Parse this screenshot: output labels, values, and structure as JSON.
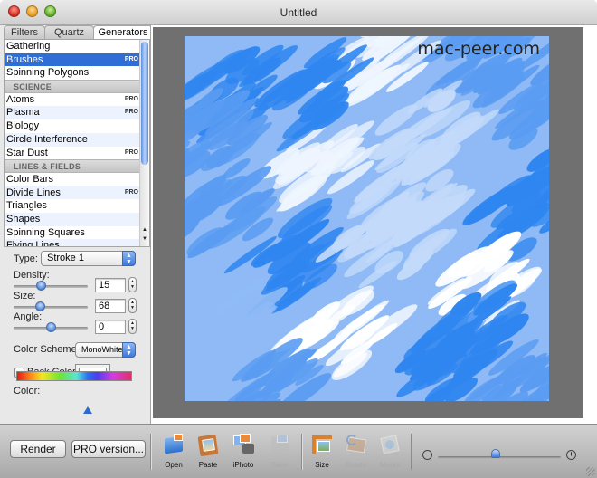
{
  "window": {
    "title": "Untitled"
  },
  "tabs": [
    {
      "label": "Filters",
      "active": false
    },
    {
      "label": "Quartz",
      "active": false
    },
    {
      "label": "Generators",
      "active": true
    }
  ],
  "list": {
    "rows": [
      {
        "kind": "item",
        "label": "Gathering",
        "pro": ""
      },
      {
        "kind": "item",
        "label": "Brushes",
        "pro": "PRO",
        "selected": true
      },
      {
        "kind": "item",
        "label": "Spinning Polygons",
        "pro": ""
      },
      {
        "kind": "group",
        "label": "SCIENCE"
      },
      {
        "kind": "item",
        "label": "Atoms",
        "pro": "PRO"
      },
      {
        "kind": "item",
        "label": "Plasma",
        "pro": "PRO"
      },
      {
        "kind": "item",
        "label": "Biology",
        "pro": ""
      },
      {
        "kind": "item",
        "label": "Circle Interference",
        "pro": ""
      },
      {
        "kind": "item",
        "label": "Star Dust",
        "pro": "PRO"
      },
      {
        "kind": "group",
        "label": "LINES & FIELDS"
      },
      {
        "kind": "item",
        "label": "Color Bars",
        "pro": ""
      },
      {
        "kind": "item",
        "label": "Divide Lines",
        "pro": "PRO"
      },
      {
        "kind": "item",
        "label": "Triangles",
        "pro": ""
      },
      {
        "kind": "item",
        "label": "Shapes",
        "pro": ""
      },
      {
        "kind": "item",
        "label": "Spinning Squares",
        "pro": ""
      },
      {
        "kind": "item",
        "label": "Flying Lines",
        "pro": ""
      }
    ]
  },
  "controls": {
    "type_label": "Type:",
    "type_value": "Stroke 1",
    "density_label": "Density:",
    "density_value": "15",
    "size_label": "Size:",
    "size_value": "68",
    "angle_label": "Angle:",
    "angle_value": "0",
    "color_scheme_label": "Color Scheme:",
    "color_scheme_value": "MonoWhite",
    "back_color_label": "Back Color:",
    "back_color_checked": false,
    "back_color_value": "#ffffff",
    "color_label": "Color:",
    "color_position": 0.62
  },
  "canvas": {
    "watermark": "mac-peer.com",
    "palette": [
      "#2f86f0",
      "#5a9cf2",
      "#8fbaf5",
      "#c3dafa",
      "#eef5fe",
      "#ffffff"
    ]
  },
  "bottom": {
    "render_label": "Render",
    "pro_label": "PRO version...",
    "tools": [
      {
        "label": "Open",
        "icon": "open-icon",
        "enabled": true
      },
      {
        "label": "Paste",
        "icon": "paste-icon",
        "enabled": true
      },
      {
        "label": "iPhoto",
        "icon": "iphoto-icon",
        "enabled": true
      },
      {
        "label": "Save",
        "icon": "save-icon",
        "enabled": false
      },
      {
        "label": "Size",
        "icon": "size-icon",
        "enabled": true
      },
      {
        "label": "Rotate",
        "icon": "rotate-icon",
        "enabled": false
      },
      {
        "label": "Masks",
        "icon": "masks-icon",
        "enabled": false
      }
    ],
    "zoom_minus": "−",
    "zoom_plus": "+",
    "zoom_level": 0.47
  }
}
